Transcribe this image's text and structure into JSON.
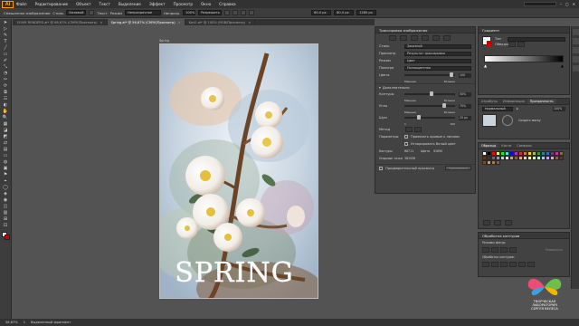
{
  "app": {
    "logo": "Ai"
  },
  "menu": [
    "Файл",
    "Редактирование",
    "Объект",
    "Текст",
    "Выделение",
    "Эффект",
    "Просмотр",
    "Окно",
    "Справка"
  ],
  "control_bar": {
    "selection_label": "Смешанное изображение",
    "style_label": "Стиль",
    "style_value": "Базовый",
    "text_label": "Текст",
    "mode_label": "Режим",
    "mode_value": "Непрозрачное",
    "opacity_label": "Непрозр.",
    "opacity_value": "100%",
    "align_value": "Разрешить",
    "x_value": "80.0 px",
    "y_value": "80.0 px",
    "w_value": "1280 px"
  },
  "tabs": [
    {
      "label": "1500R RENDERS.ai* @ 66,67% (CMYK/Просмотр)",
      "active": false
    },
    {
      "label": "Spring.ai* @ 56,67% (CMYK/Просмотр)",
      "active": true
    },
    {
      "label": "Без2.ai* @ 100% (RGB/Просмотр)",
      "active": false
    }
  ],
  "tools": [
    "➤",
    "▷",
    "✎",
    "T",
    "╱",
    "▭",
    "✐",
    "⤡",
    "◔",
    "✂",
    "⟳",
    "⧉",
    "☷",
    "◐",
    "✋",
    "🔍",
    "▦",
    "◪",
    "◩",
    "⇄",
    "▤",
    "▭",
    "◍",
    "▣",
    "⚑",
    "⌖",
    "◯",
    "◈",
    "◉",
    "◫",
    "▥",
    "⊞",
    "⊡"
  ],
  "artboard": {
    "label": "Spring",
    "title_text": "SPRING"
  },
  "transparency_panel": {
    "title": "Трассировка изображения",
    "rows": [
      {
        "label": "Стиль",
        "value": "Заказной"
      },
      {
        "label": "Просмотр",
        "value": "Результат трассировки"
      },
      {
        "label": "Режим",
        "value": "Цвет"
      },
      {
        "label": "Палитра",
        "value": "Полноцветная"
      }
    ],
    "color_label": "Цвета",
    "color_value": "100",
    "color_min": "Меньше",
    "color_max": "Больше",
    "advanced_label": "Дополнительно",
    "sliders": [
      {
        "label": "Контуры",
        "value": "50%",
        "min": "Меньше",
        "max": "Больше",
        "level": 0.5
      },
      {
        "label": "Углы",
        "value": "75%",
        "min": "Меньше",
        "max": "Больше",
        "level": 0.75
      },
      {
        "label": "Шум",
        "value": "25 px",
        "min": "1",
        "max": "100",
        "level": 0.25
      }
    ],
    "method_label": "Метод",
    "options_label": "Параметры",
    "opt1": "Привязать кривые к линиям",
    "opt2": "Игнорировать белый цвет",
    "paths_label": "Контуры",
    "paths_value": "86711",
    "colors_count_label": "Цвета",
    "colors_count_value": "91690",
    "anchors_label": "Опорные точки",
    "anchors_value": "381936",
    "preview_label": "Предварительный просмотр",
    "trace_button": "Трассировка"
  },
  "gradient_panel": {
    "title": "Градиент",
    "type_label": "Тип",
    "stroke_label": "Обводка"
  },
  "appearance_panel": {
    "tabs": [
      "Атрибуты",
      "Информация",
      "Прозрачность"
    ],
    "active_tab": "Прозрачность",
    "blend_mode": "Нормальный",
    "opacity": "100%",
    "make_mask": "Создать маску"
  },
  "swatches_panel": {
    "tabs": [
      "Образцы",
      "Кисти",
      "Символы"
    ],
    "active_tab": "Образцы"
  },
  "pathfinder_panel": {
    "title": "Обработка контуров",
    "shape_modes": "Режимы фигур:",
    "expand": "Развернуть",
    "pathfinders": "Обработка контуров:"
  },
  "swatch_colors": [
    "#ffffff",
    "#000000",
    "#ff0000",
    "#ffff00",
    "#00ff00",
    "#00ffff",
    "#0000ff",
    "#ff00ff",
    "#cc3333",
    "#ff6600",
    "#ffcc00",
    "#99cc33",
    "#339933",
    "#009999",
    "#3366cc",
    "#663399",
    "#cc3399",
    "#996633",
    "#663300",
    "#333333",
    "#666666",
    "#999999",
    "#cccccc",
    "#e6e6e6",
    "#c8a27a",
    "#b35900",
    "#ff9999",
    "#ffcc99",
    "#ffff99",
    "#ccff99",
    "#99ffcc",
    "#99ccff",
    "#cc99ff",
    "#ff99cc",
    "#8c6239",
    "#603913",
    "#754c24",
    "#c69c6d",
    "#a67c52",
    "#736357"
  ],
  "status": {
    "zoom": "56,67%",
    "page": "1",
    "tool": "Выделенный фрагмент"
  },
  "watermark": {
    "line1": "ТВОРЧЕСКАЯ",
    "line2": "ЛАБОРАТОРИЯ",
    "line3": "СЕРГЕЯ ВЕЛЕСА"
  },
  "colors": {
    "accent": "#ff9a00",
    "ui_dark": "#323232",
    "ui_mid": "#424242",
    "canvas": "#535353"
  }
}
